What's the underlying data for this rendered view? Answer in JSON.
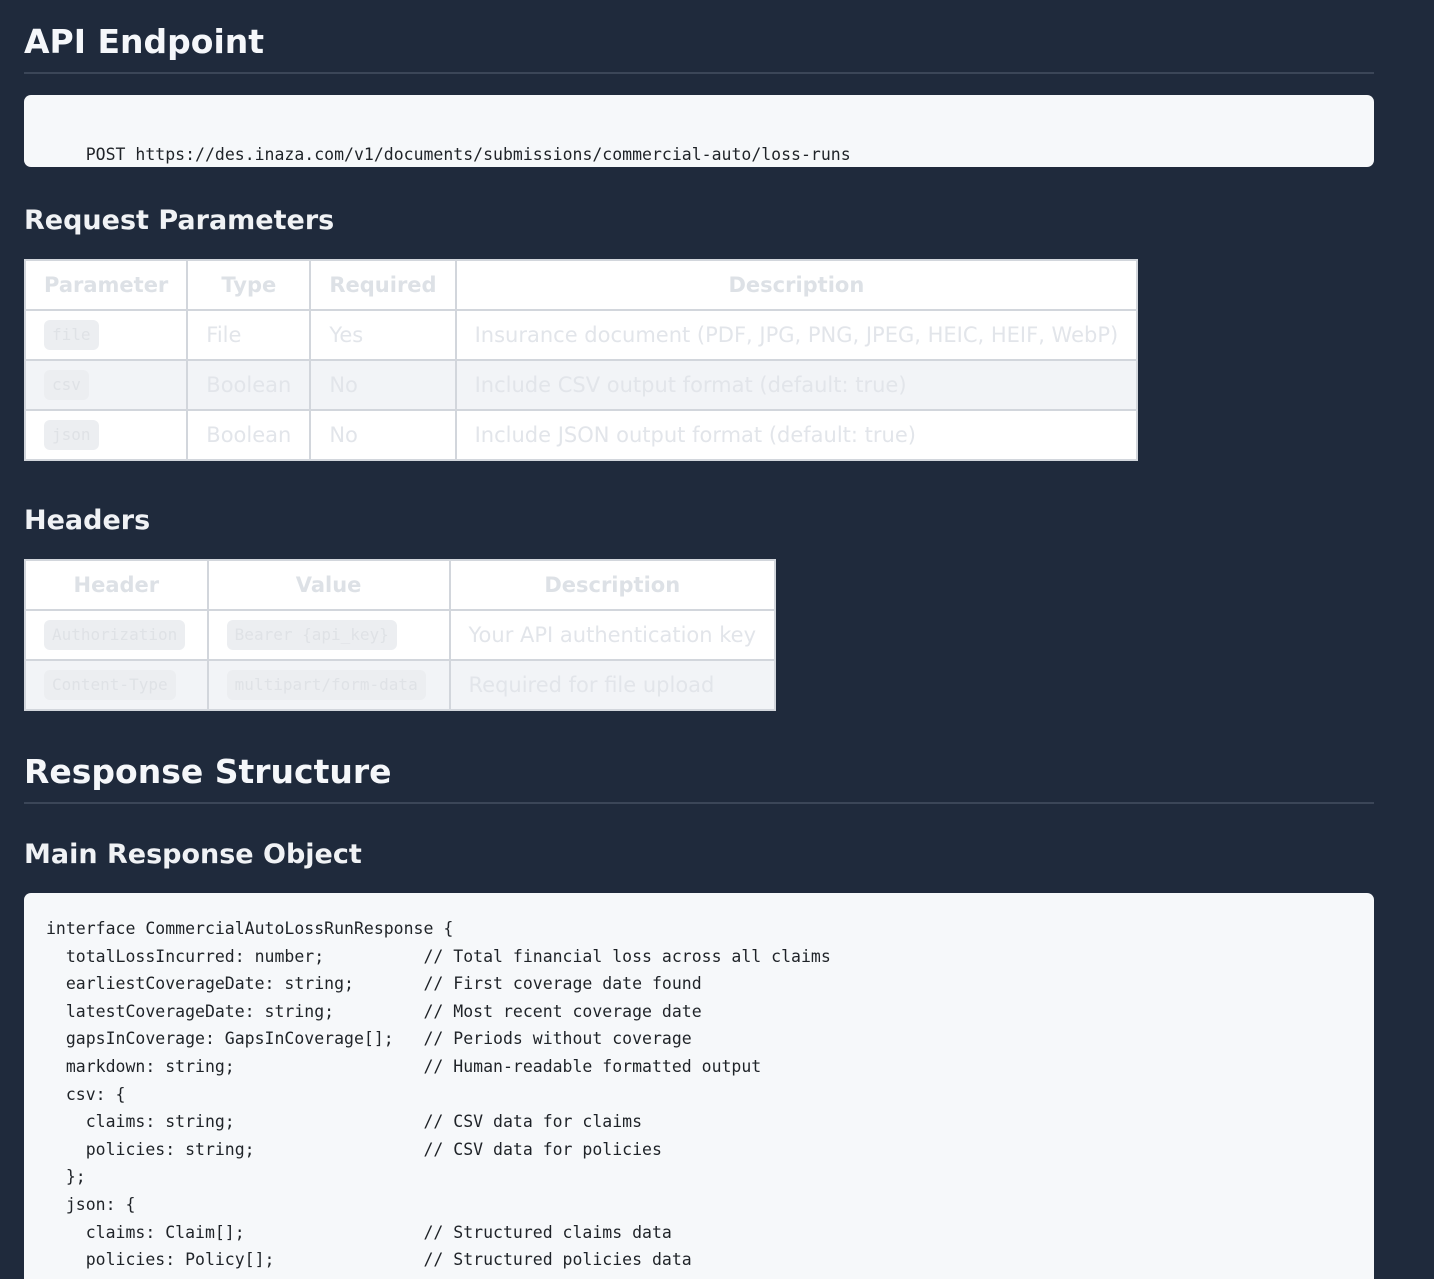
{
  "api_endpoint": {
    "title": "API Endpoint",
    "request": "POST https://des.inaza.com/v1/documents/submissions/commercial-auto/loss-runs"
  },
  "request_parameters": {
    "title": "Request Parameters",
    "columns": [
      "Parameter",
      "Type",
      "Required",
      "Description"
    ],
    "rows": [
      {
        "parameter": "file",
        "type": "File",
        "required": "Yes",
        "description": "Insurance document (PDF, JPG, PNG, JPEG, HEIC, HEIF, WebP)"
      },
      {
        "parameter": "csv",
        "type": "Boolean",
        "required": "No",
        "description": "Include CSV output format (default: true)"
      },
      {
        "parameter": "json",
        "type": "Boolean",
        "required": "No",
        "description": "Include JSON output format (default: true)"
      }
    ]
  },
  "headers": {
    "title": "Headers",
    "columns": [
      "Header",
      "Value",
      "Description"
    ],
    "rows": [
      {
        "header": "Authorization",
        "value": "Bearer {api_key}",
        "description": "Your API authentication key"
      },
      {
        "header": "Content-Type",
        "value": "multipart/form-data",
        "description": "Required for file upload"
      }
    ]
  },
  "response_structure": {
    "title": "Response Structure",
    "main_object_title": "Main Response Object",
    "code_lines": [
      "interface CommercialAutoLossRunResponse {",
      "  totalLossIncurred: number;          // Total financial loss across all claims",
      "  earliestCoverageDate: string;       // First coverage date found",
      "  latestCoverageDate: string;         // Most recent coverage date",
      "  gapsInCoverage: GapsInCoverage[];   // Periods without coverage",
      "  markdown: string;                   // Human-readable formatted output",
      "  csv: {",
      "    claims: string;                   // CSV data for claims",
      "    policies: string;                 // CSV data for policies",
      "  };",
      "  json: {",
      "    claims: Claim[];                  // Structured claims data",
      "    policies: Policy[];               // Structured policies data"
    ]
  }
}
